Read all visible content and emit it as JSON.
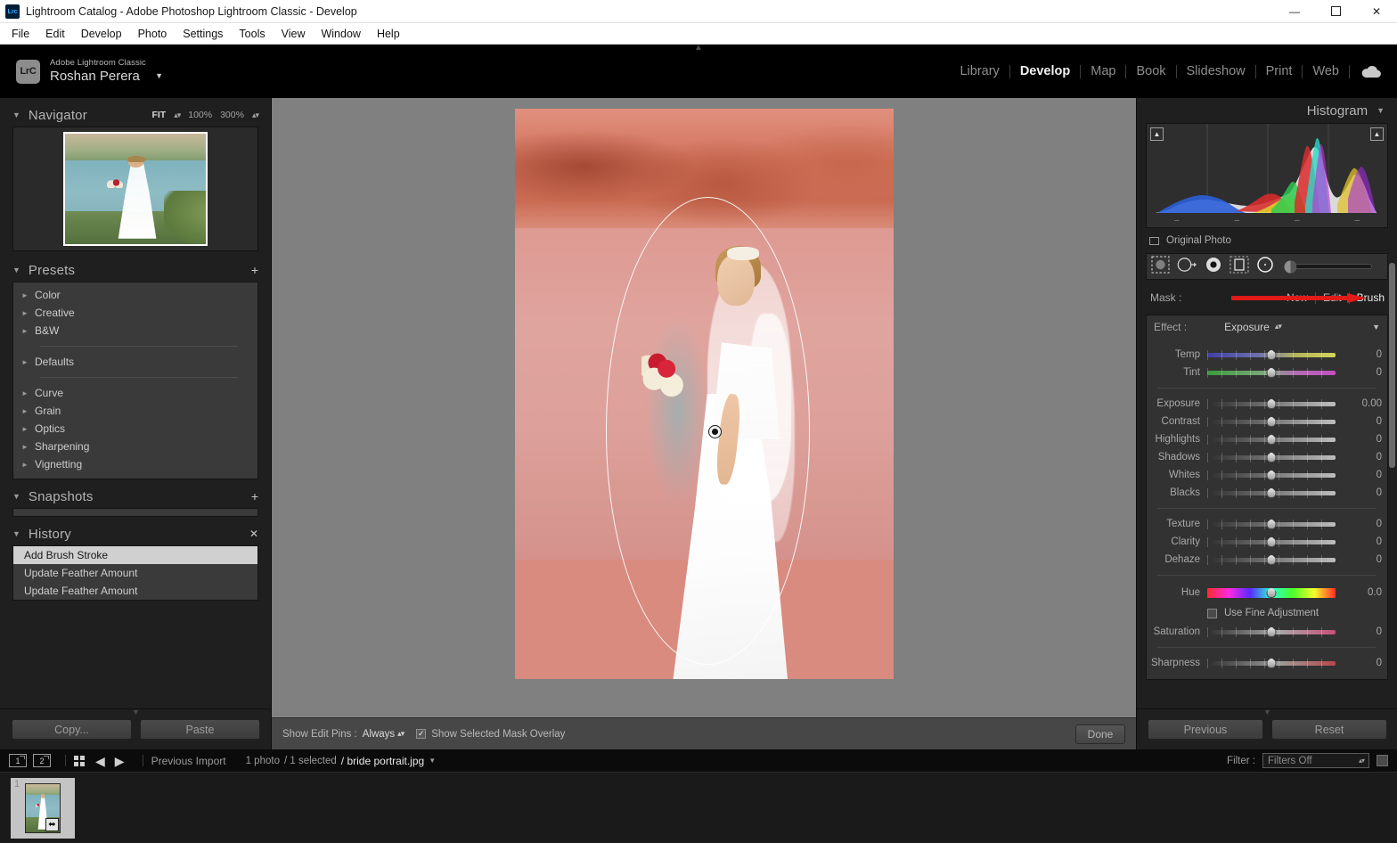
{
  "window": {
    "title": "Lightroom Catalog - Adobe Photoshop Lightroom Classic - Develop",
    "app_icon": "Lrc",
    "minimize": "—",
    "maximize": "☐",
    "close": "✕"
  },
  "menubar": {
    "items": [
      "File",
      "Edit",
      "Develop",
      "Photo",
      "Settings",
      "Tools",
      "View",
      "Window",
      "Help"
    ]
  },
  "identity": {
    "badge": "LrC",
    "product": "Adobe Lightroom Classic",
    "user": "Roshan Perera",
    "caret": "▼"
  },
  "modules": {
    "items": [
      "Library",
      "Develop",
      "Map",
      "Book",
      "Slideshow",
      "Print",
      "Web"
    ],
    "active": "Develop",
    "cloud_icon": "cloud-icon"
  },
  "left": {
    "navigator": {
      "title": "Navigator",
      "fit": "FIT",
      "zoom_100": "100%",
      "zoom_300": "300%"
    },
    "presets": {
      "title": "Presets",
      "add_label": "+",
      "groups_top": [
        "Color",
        "Creative",
        "B&W"
      ],
      "groups_mid": [
        "Defaults"
      ],
      "groups_bottom": [
        "Curve",
        "Grain",
        "Optics",
        "Sharpening",
        "Vignetting"
      ]
    },
    "snapshots": {
      "title": "Snapshots",
      "add_label": "+"
    },
    "history": {
      "title": "History",
      "clear_label": "✕",
      "entries": [
        "Add Brush Stroke",
        "Update Feather Amount",
        "Update Feather Amount"
      ],
      "selected_index": 0
    },
    "buttons": {
      "copy": "Copy...",
      "paste": "Paste"
    }
  },
  "toolbar": {
    "show_edit_pins_label": "Show Edit Pins :",
    "show_edit_pins_value": "Always",
    "show_mask_overlay_label": "Show Selected Mask Overlay",
    "show_mask_overlay_checked": true,
    "done": "Done"
  },
  "right": {
    "histogram": {
      "title": "Histogram",
      "caret": "▼",
      "original_photo": "Original Photo"
    },
    "mask_tools": [
      "select-subject-icon",
      "linear-gradient-icon",
      "radial-gradient-icon",
      "color-range-icon",
      "brush-circle-icon",
      "brush-size-slider"
    ],
    "mask": {
      "label": "Mask :",
      "new_label": "New",
      "edit_label": "Edit",
      "brush_label": "Brush",
      "arrow_color": "#e01b18"
    },
    "effect": {
      "label": "Effect :",
      "value": "Exposure",
      "caret": "▼"
    },
    "sliders_group_1": [
      {
        "name": "Temp",
        "value": "0",
        "track": "temp"
      },
      {
        "name": "Tint",
        "value": "0",
        "track": "tint"
      }
    ],
    "sliders_group_2": [
      {
        "name": "Exposure",
        "value": "0.00",
        "track": "flat"
      },
      {
        "name": "Contrast",
        "value": "0",
        "track": "flat"
      },
      {
        "name": "Highlights",
        "value": "0",
        "track": "flat"
      },
      {
        "name": "Shadows",
        "value": "0",
        "track": "flat"
      },
      {
        "name": "Whites",
        "value": "0",
        "track": "flat"
      },
      {
        "name": "Blacks",
        "value": "0",
        "track": "flat"
      }
    ],
    "sliders_group_3": [
      {
        "name": "Texture",
        "value": "0",
        "track": "flat"
      },
      {
        "name": "Clarity",
        "value": "0",
        "track": "flat"
      },
      {
        "name": "Dehaze",
        "value": "0",
        "track": "flat"
      }
    ],
    "hue_slider": {
      "name": "Hue",
      "value": "0.0",
      "track": "hue"
    },
    "fine_adjustment": {
      "label": "Use Fine Adjustment",
      "checked": false
    },
    "saturation_slider": {
      "name": "Saturation",
      "value": "0",
      "track": "sat"
    },
    "sharpness_slider": {
      "name": "Sharpness",
      "value": "0",
      "track": "sharp"
    },
    "buttons": {
      "previous": "Previous",
      "reset": "Reset"
    }
  },
  "filmstrip_bar": {
    "screen1": "1",
    "screen2": "2",
    "grid_icon": "grid-view-icon",
    "back_arrow": "◀",
    "forward_arrow": "▶",
    "source": "Previous Import",
    "count": "1 photo",
    "selected": "/ 1 selected",
    "filename": "/ bride portrait.jpg",
    "file_caret": "▼",
    "filter_label": "Filter :",
    "filter_value": "Filters Off"
  },
  "filmstrip": {
    "cells": [
      {
        "index": "1",
        "badge": "⬌"
      }
    ]
  }
}
